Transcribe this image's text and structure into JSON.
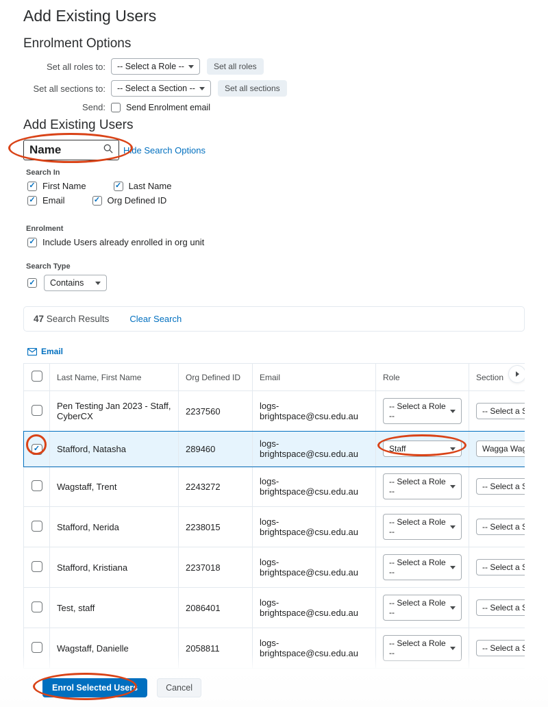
{
  "page_title": "Add Existing Users",
  "enrolment": {
    "heading": "Enrolment Options",
    "set_roles_label": "Set all roles to:",
    "set_roles_value": "-- Select a Role --",
    "set_roles_btn": "Set all roles",
    "set_sections_label": "Set all sections to:",
    "set_sections_value": "-- Select a Section --",
    "set_sections_btn": "Set all sections",
    "send_label": "Send:",
    "send_text": "Send Enrolment email"
  },
  "search": {
    "heading": "Add Existing Users",
    "value": "Name",
    "hide_options": "Hide Search Options",
    "search_in_label": "Search In",
    "opts": {
      "first_name": "First Name",
      "last_name": "Last Name",
      "email": "Email",
      "org_defined": "Org Defined ID"
    },
    "enrolment_label": "Enrolment",
    "include_enrolled": "Include Users already enrolled in org unit",
    "search_type_label": "Search Type",
    "search_type_value": "Contains"
  },
  "results": {
    "count": "47",
    "count_label": "Search Results",
    "clear": "Clear Search",
    "email_action": "Email"
  },
  "table": {
    "headers": {
      "name": "Last Name, First Name",
      "org": "Org Defined ID",
      "email": "Email",
      "role": "Role",
      "section": "Section"
    },
    "default_role": "-- Select a Role --",
    "default_section": "-- Select a Sectio",
    "rows": [
      {
        "checked": false,
        "name": "Pen Testing Jan 2023 - Staff, CyberCX",
        "org": "2237560",
        "email": "logs-brightspace@csu.edu.au",
        "role": "-- Select a Role --",
        "section": "-- Select a Sectio"
      },
      {
        "checked": true,
        "name": "Stafford, Natasha",
        "org": "289460",
        "email": "logs-brightspace@csu.edu.au",
        "role": "Staff",
        "section": "Wagga Wagga D"
      },
      {
        "checked": false,
        "name": "Wagstaff, Trent",
        "org": "2243272",
        "email": "logs-brightspace@csu.edu.au",
        "role": "-- Select a Role --",
        "section": "-- Select a Sectio"
      },
      {
        "checked": false,
        "name": "Stafford, Nerida",
        "org": "2238015",
        "email": "logs-brightspace@csu.edu.au",
        "role": "-- Select a Role --",
        "section": "-- Select a Sectio"
      },
      {
        "checked": false,
        "name": "Stafford, Kristiana",
        "org": "2237018",
        "email": "logs-brightspace@csu.edu.au",
        "role": "-- Select a Role --",
        "section": "-- Select a Sectio"
      },
      {
        "checked": false,
        "name": "Test, staff",
        "org": "2086401",
        "email": "logs-brightspace@csu.edu.au",
        "role": "-- Select a Role --",
        "section": "-- Select a Sectio"
      },
      {
        "checked": false,
        "name": "Wagstaff, Danielle",
        "org": "2058811",
        "email": "logs-brightspace@csu.edu.au",
        "role": "-- Select a Role --",
        "section": "-- Select a Sectio"
      }
    ]
  },
  "footer": {
    "enrol": "Enrol Selected Users",
    "cancel": "Cancel"
  }
}
